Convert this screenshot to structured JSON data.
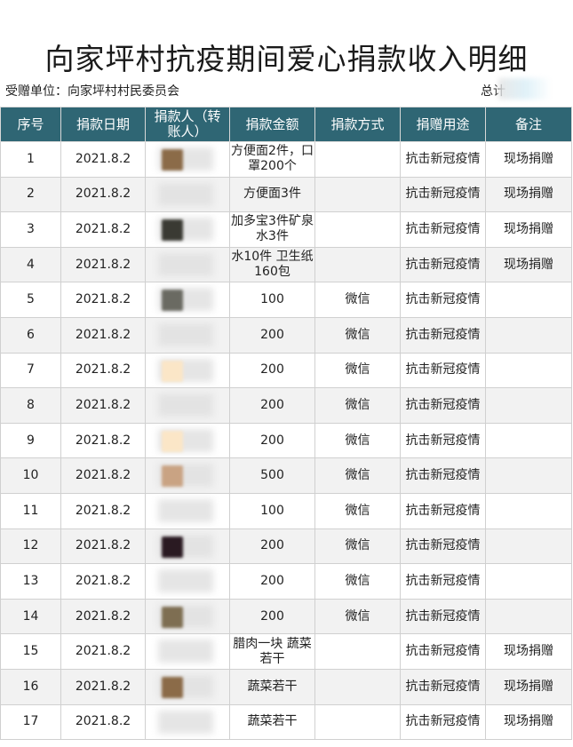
{
  "title": "向家坪村抗疫期间爱心捐款收入明细",
  "recipient": "受赠单位：向家坪村村民委员会",
  "total_label": "总计",
  "columns": [
    "序号",
    "捐款日期",
    "捐款人（转账人）",
    "捐款金额",
    "捐款方式",
    "捐赠用途",
    "备注"
  ],
  "rows": [
    {
      "no": "1",
      "date": "2021.8.2",
      "donor": "",
      "amount": "方便面2件，口罩200个",
      "method": "",
      "purpose": "抗击新冠疫情",
      "note": "现场捐赠",
      "swatch": "#8b6b48"
    },
    {
      "no": "2",
      "date": "2021.8.2",
      "donor": "",
      "amount": "方便面3件",
      "method": "",
      "purpose": "抗击新冠疫情",
      "note": "现场捐赠",
      "swatch": ""
    },
    {
      "no": "3",
      "date": "2021.8.2",
      "donor": "",
      "amount": "加多宝3件矿泉水3件",
      "method": "",
      "purpose": "抗击新冠疫情",
      "note": "现场捐赠",
      "swatch": "#3a3a33"
    },
    {
      "no": "4",
      "date": "2021.8.2",
      "donor": "",
      "amount": "水10件 卫生纸160包",
      "method": "",
      "purpose": "抗击新冠疫情",
      "note": "现场捐赠",
      "swatch": ""
    },
    {
      "no": "5",
      "date": "2021.8.2",
      "donor": "",
      "amount": "100",
      "method": "微信",
      "purpose": "抗击新冠疫情",
      "note": "",
      "swatch": "#6a6a62"
    },
    {
      "no": "6",
      "date": "2021.8.2",
      "donor": "",
      "amount": "200",
      "method": "微信",
      "purpose": "抗击新冠疫情",
      "note": "",
      "swatch": ""
    },
    {
      "no": "7",
      "date": "2021.8.2",
      "donor": "",
      "amount": "200",
      "method": "微信",
      "purpose": "抗击新冠疫情",
      "note": "",
      "swatch": "#fbe6c7"
    },
    {
      "no": "8",
      "date": "2021.8.2",
      "donor": "",
      "amount": "200",
      "method": "微信",
      "purpose": "抗击新冠疫情",
      "note": "",
      "swatch": ""
    },
    {
      "no": "9",
      "date": "2021.8.2",
      "donor": "",
      "amount": "200",
      "method": "微信",
      "purpose": "抗击新冠疫情",
      "note": "",
      "swatch": "#fbe6c7"
    },
    {
      "no": "10",
      "date": "2021.8.2",
      "donor": "",
      "amount": "500",
      "method": "微信",
      "purpose": "抗击新冠疫情",
      "note": "",
      "swatch": "#c9a383"
    },
    {
      "no": "11",
      "date": "2021.8.2",
      "donor": "",
      "amount": "100",
      "method": "微信",
      "purpose": "抗击新冠疫情",
      "note": "",
      "swatch": ""
    },
    {
      "no": "12",
      "date": "2021.8.2",
      "donor": "",
      "amount": "200",
      "method": "微信",
      "purpose": "抗击新冠疫情",
      "note": "",
      "swatch": "#2a1a22"
    },
    {
      "no": "13",
      "date": "2021.8.2",
      "donor": "",
      "amount": "200",
      "method": "微信",
      "purpose": "抗击新冠疫情",
      "note": "",
      "swatch": ""
    },
    {
      "no": "14",
      "date": "2021.8.2",
      "donor": "",
      "amount": "200",
      "method": "微信",
      "purpose": "抗击新冠疫情",
      "note": "",
      "swatch": "#7e6e52"
    },
    {
      "no": "15",
      "date": "2021.8.2",
      "donor": "",
      "amount": "腊肉一块 蔬菜若干",
      "method": "",
      "purpose": "抗击新冠疫情",
      "note": "现场捐赠",
      "swatch": ""
    },
    {
      "no": "16",
      "date": "2021.8.2",
      "donor": "",
      "amount": "蔬菜若干",
      "method": "",
      "purpose": "抗击新冠疫情",
      "note": "现场捐赠",
      "swatch": "#8b6b48"
    },
    {
      "no": "17",
      "date": "2021.8.2",
      "donor": "",
      "amount": "蔬菜若干",
      "method": "",
      "purpose": "抗击新冠疫情",
      "note": "现场捐赠",
      "swatch": ""
    }
  ],
  "colors": {
    "header_bg": "#2f6674",
    "header_text": "#ffffff",
    "stripe": "#f2f2f2",
    "border": "#d0d0d0"
  }
}
